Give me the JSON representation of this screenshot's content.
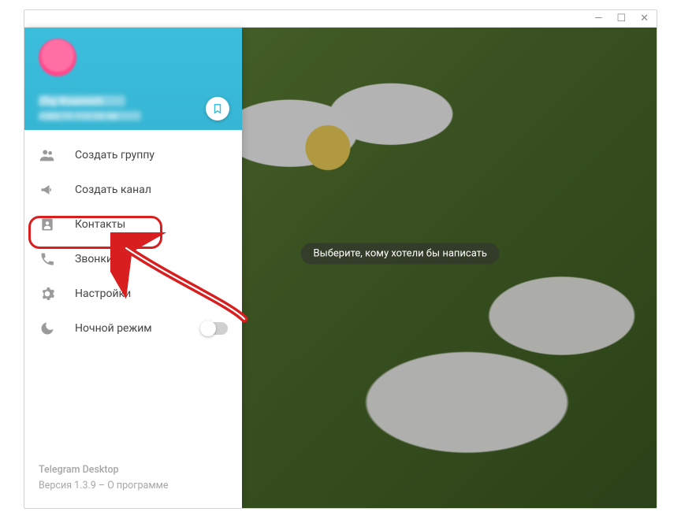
{
  "titlebar": {
    "minimize": "—",
    "maximize": "☐",
    "close": "✕"
  },
  "header": {
    "user_name": "Zhy Ksamich",
    "user_phone": "+385 71 112 05 98"
  },
  "menu": {
    "items": [
      {
        "icon": "group-icon",
        "label": "Создать группу"
      },
      {
        "icon": "megaphone-icon",
        "label": "Создать канал"
      },
      {
        "icon": "contacts-icon",
        "label": "Контакты"
      },
      {
        "icon": "phone-icon",
        "label": "Звонки"
      },
      {
        "icon": "gear-icon",
        "label": "Настройки"
      },
      {
        "icon": "moon-icon",
        "label": "Ночной режим"
      }
    ]
  },
  "footer": {
    "app_name": "Telegram Desktop",
    "version_line": "Версия 1.3.9 – О программе"
  },
  "chat": {
    "hint": "Выберите, кому хотели бы написать"
  }
}
